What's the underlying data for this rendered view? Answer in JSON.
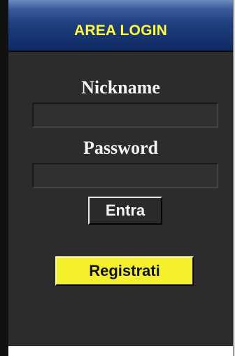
{
  "login_panel": {
    "title": "AREA LOGIN",
    "nickname_label": "Nickname",
    "nickname_value": "",
    "password_label": "Password",
    "password_value": "",
    "submit_label": "Entra",
    "register_label": "Registrati"
  },
  "colors": {
    "panel_background": "#2c2c2c",
    "header_gradient_top": "#6f8bbf",
    "header_gradient_bottom": "#0e2a63",
    "title_text": "#ffff33",
    "register_button": "#f4f02a"
  }
}
